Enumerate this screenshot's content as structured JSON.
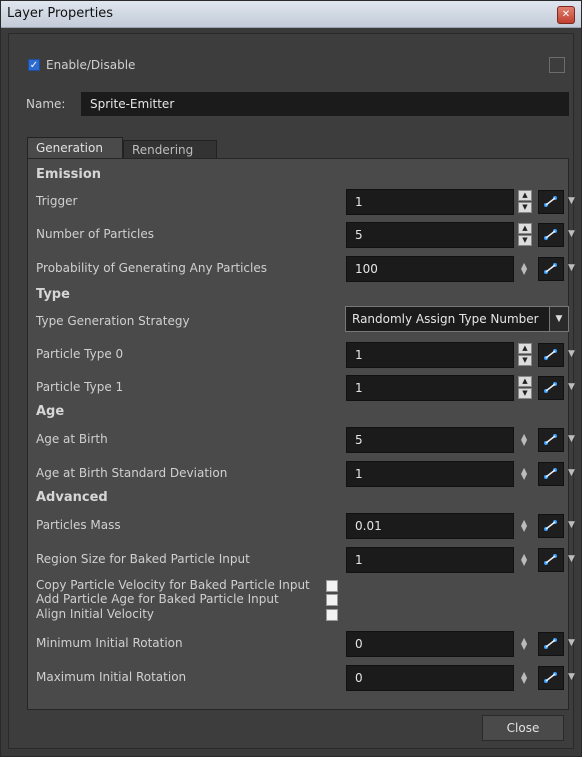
{
  "window": {
    "title": "Layer Properties",
    "close_glyph": "✕"
  },
  "enable": {
    "label": "Enable/Disable",
    "checked": true
  },
  "name": {
    "label": "Name:",
    "value": "Sprite-Emitter"
  },
  "tabs": [
    {
      "label": "Generation",
      "active": true
    },
    {
      "label": "Rendering",
      "active": false
    }
  ],
  "sections": {
    "emission": "Emission",
    "type": "Type",
    "age": "Age",
    "advanced": "Advanced"
  },
  "rows": {
    "trigger": {
      "label": "Trigger",
      "value": "1"
    },
    "num_particles": {
      "label": "Number of Particles",
      "value": "5"
    },
    "probability": {
      "label": "Probability of Generating Any Particles",
      "value": "100"
    },
    "type_strategy": {
      "label": "Type Generation Strategy",
      "value": "Randomly Assign Type Number"
    },
    "particle_type_0": {
      "label": "Particle Type 0",
      "value": "1"
    },
    "particle_type_1": {
      "label": "Particle Type 1",
      "value": "1"
    },
    "age_at_birth": {
      "label": "Age at Birth",
      "value": "5"
    },
    "age_std_dev": {
      "label": "Age at Birth Standard Deviation",
      "value": "1"
    },
    "particles_mass": {
      "label": "Particles Mass",
      "value": "0.01"
    },
    "region_size": {
      "label": "Region Size for Baked Particle Input",
      "value": "1"
    },
    "copy_velocity": {
      "label": "Copy Particle Velocity for Baked Particle Input",
      "checked": false
    },
    "add_age": {
      "label": "Add Particle Age for Baked Particle Input",
      "checked": false
    },
    "align_velocity": {
      "label": "Align Initial Velocity",
      "checked": false
    },
    "min_rotation": {
      "label": "Minimum Initial Rotation",
      "value": "0"
    },
    "max_rotation": {
      "label": "Maximum Initial Rotation",
      "value": "0"
    }
  },
  "buttons": {
    "close": "Close"
  },
  "colors": {
    "accent": "#2e6bd0",
    "panel": "#4a4a4a",
    "field": "#1b1b1b"
  }
}
